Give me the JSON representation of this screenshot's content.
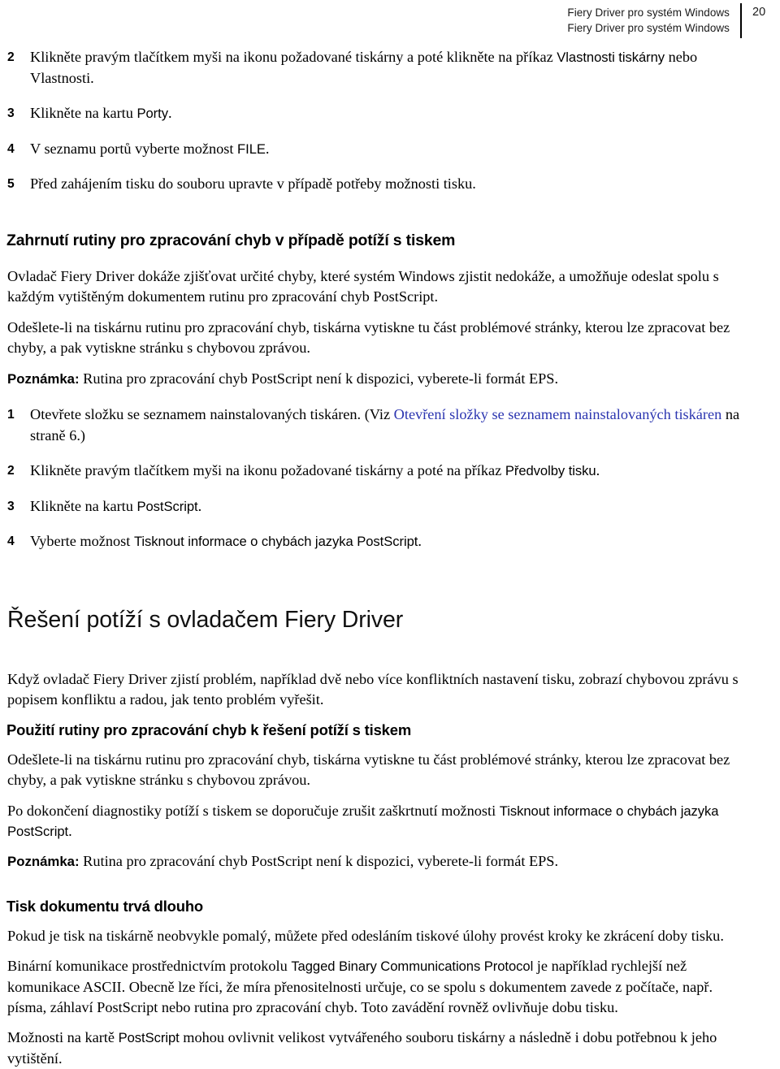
{
  "header": {
    "title_line_1": "Fiery Driver pro systém Windows",
    "title_line_2": "Fiery Driver pro systém Windows",
    "page_number": "20"
  },
  "colors": {
    "link": "#2b35b0",
    "text": "#000000",
    "header_text": "#1a1a1a"
  },
  "steps_top": [
    {
      "number": "2",
      "text_before": "Klikněte pravým tlačítkem myši na ikonu požadované tiskárny a poté klikněte na příkaz ",
      "ui_term": "Vlastnosti tiskárny",
      "text_after": " nebo Vlastnosti."
    },
    {
      "number": "3",
      "text_before": "Klikněte na kartu ",
      "ui_term": "Porty",
      "text_after": "."
    },
    {
      "number": "4",
      "text_before": "V seznamu portů vyberte možnost ",
      "ui_term": "FILE",
      "text_after": "."
    },
    {
      "number": "5",
      "text_before": "Před zahájením tisku do souboru upravte v případě potřeby možnosti tisku.",
      "ui_term": "",
      "text_after": ""
    }
  ],
  "section_error_handler": {
    "heading": "Zahrnutí rutiny pro zpracování chyb v případě potíží s tiskem",
    "paragraph_1": "Ovladač Fiery Driver dokáže zjišťovat určité chyby, které systém Windows zjistit nedokáže, a umožňuje odeslat spolu s každým vytištěným dokumentem rutinu pro zpracování chyb PostScript.",
    "paragraph_2": "Odešlete-li na tiskárnu rutinu pro zpracování chyb, tiskárna vytiskne tu část problémové stránky, kterou lze zpracovat bez chyby, a pak vytiskne stránku s chybovou zprávou.",
    "note_label": "Poznámka:",
    "note_text": " Rutina pro zpracování chyb PostScript není k dispozici, vyberete-li formát EPS.",
    "steps": [
      {
        "number": "1",
        "text_before": "Otevřete složku se seznamem nainstalovaných tiskáren. (Viz ",
        "link_text": "Otevření složky se seznamem nainstalovaných tiskáren",
        "text_after": " na straně 6.)"
      },
      {
        "number": "2",
        "text_before": "Klikněte pravým tlačítkem myši na ikonu požadované tiskárny a poté na příkaz ",
        "ui_term": "Předvolby tisku",
        "text_after": "."
      },
      {
        "number": "3",
        "text_before": "Klikněte na kartu ",
        "ui_term": "PostScript",
        "text_after": "."
      },
      {
        "number": "4",
        "text_before": "Vyberte možnost ",
        "ui_term": "Tisknout informace o chybách jazyka PostScript",
        "text_after": "."
      }
    ]
  },
  "section_troubleshooting": {
    "heading": "Řešení potíží s ovladačem Fiery Driver",
    "intro": "Když ovladač Fiery Driver zjistí problém, například dvě nebo více konfliktních nastavení tisku, zobrazí chybovou zprávu s popisem konfliktu a radou, jak tento problém vyřešit.",
    "sub_heading": "Použití rutiny pro zpracování chyb k řešení potíží s tiskem",
    "paragraph_1": "Odešlete-li na tiskárnu rutinu pro zpracování chyb, tiskárna vytiskne tu část problémové stránky, kterou lze zpracovat bez chyby, a pak vytiskne stránku s chybovou zprávou.",
    "paragraph_2_before": "Po dokončení diagnostiky potíží s tiskem se doporučuje zrušit zaškrtnutí možnosti ",
    "paragraph_2_ui": "Tisknout informace o chybách jazyka PostScript",
    "paragraph_2_after": ".",
    "note_label": "Poznámka:",
    "note_text": " Rutina pro zpracování chyb PostScript není k dispozici, vyberete-li formát EPS."
  },
  "section_slow_print": {
    "heading": "Tisk dokumentu trvá dlouho",
    "paragraph_1": "Pokud je tisk na tiskárně neobvykle pomalý, můžete před odesláním tiskové úlohy provést kroky ke zkrácení doby tisku.",
    "paragraph_2_before": "Binární komunikace prostřednictvím protokolu ",
    "paragraph_2_ui": "Tagged Binary Communications Protocol",
    "paragraph_2_after": " je například rychlejší než komunikace ASCII. Obecně lze říci, že míra přenositelnosti určuje, co se spolu s dokumentem zavede z počítače, např. písma, záhlaví PostScript nebo rutina pro zpracování chyb. Toto zavádění rovněž ovlivňuje dobu tisku.",
    "paragraph_3_before": "Možnosti na kartě ",
    "paragraph_3_ui": "PostScript",
    "paragraph_3_after": " mohou ovlivnit velikost vytvářeného souboru tiskárny a následně i dobu potřebnou k jeho vytištění."
  }
}
